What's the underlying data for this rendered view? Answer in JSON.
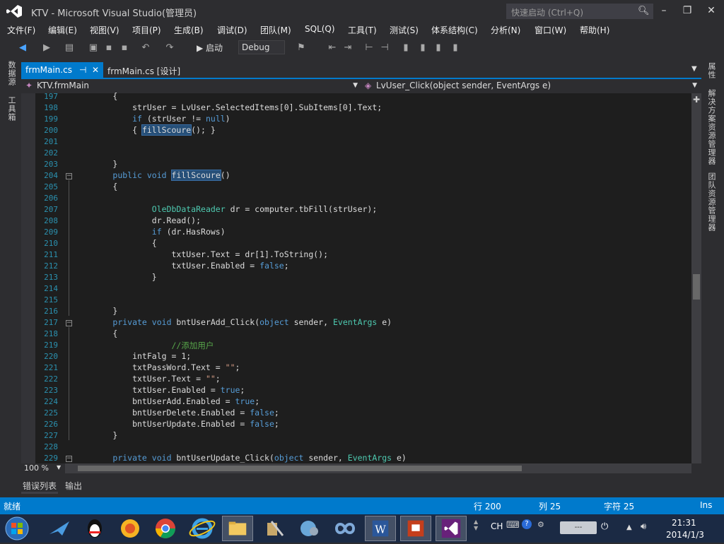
{
  "window": {
    "title": "KTV - Microsoft Visual Studio(管理员)",
    "quick_launch_placeholder": "快速启动 (Ctrl+Q)",
    "controls": {
      "minimize": "–",
      "maximize": "❐",
      "close": "✕"
    }
  },
  "menu": [
    "文件(F)",
    "编辑(E)",
    "视图(V)",
    "项目(P)",
    "生成(B)",
    "调试(D)",
    "团队(M)",
    "SQL(Q)",
    "工具(T)",
    "测试(S)",
    "体系结构(C)",
    "分析(N)",
    "窗口(W)",
    "帮助(H)"
  ],
  "toolbar": {
    "start_label": "▶ 启动",
    "configuration": "Debug"
  },
  "left_rail": [
    "数据源",
    "工具箱"
  ],
  "right_rail": [
    "属性",
    "解决方案资源管理器",
    "团队资源管理器"
  ],
  "tabs": [
    {
      "label": "frmMain.cs",
      "pin": "⊣",
      "close": "✕"
    },
    {
      "label": "frmMain.cs [设计]"
    }
  ],
  "navbar": {
    "class": "KTV.frmMain",
    "member": "LvUser_Click(object sender, EventArgs e)"
  },
  "code_lines": [
    {
      "n": "197",
      "text": "        {"
    },
    {
      "n": "198",
      "text": "            strUser = LvUser.SelectedItems[0].SubItems[0].Text;"
    },
    {
      "n": "199",
      "text": "            if (strUser != null)"
    },
    {
      "n": "200",
      "text": "            { fillScoure(); }"
    },
    {
      "n": "201",
      "text": ""
    },
    {
      "n": "202",
      "text": ""
    },
    {
      "n": "203",
      "text": "        }"
    },
    {
      "n": "204",
      "text": "        public void fillScoure()"
    },
    {
      "n": "205",
      "text": "        {"
    },
    {
      "n": "206",
      "text": ""
    },
    {
      "n": "207",
      "text": "                OleDbDataReader dr = computer.tbFill(strUser);"
    },
    {
      "n": "208",
      "text": "                dr.Read();"
    },
    {
      "n": "209",
      "text": "                if (dr.HasRows)"
    },
    {
      "n": "210",
      "text": "                {"
    },
    {
      "n": "211",
      "text": "                    txtUser.Text = dr[1].ToString();"
    },
    {
      "n": "212",
      "text": "                    txtUser.Enabled = false;"
    },
    {
      "n": "213",
      "text": "                }"
    },
    {
      "n": "214",
      "text": ""
    },
    {
      "n": "215",
      "text": ""
    },
    {
      "n": "216",
      "text": "        }"
    },
    {
      "n": "217",
      "text": "        private void bntUserAdd_Click(object sender, EventArgs e)"
    },
    {
      "n": "218",
      "text": "        {"
    },
    {
      "n": "219",
      "text": "                    //添加用户"
    },
    {
      "n": "220",
      "text": "            intFalg = 1;"
    },
    {
      "n": "221",
      "text": "            txtPassWord.Text = \"\";"
    },
    {
      "n": "222",
      "text": "            txtUser.Text = \"\";"
    },
    {
      "n": "223",
      "text": "            txtUser.Enabled = true;"
    },
    {
      "n": "224",
      "text": "            bntUserAdd.Enabled = true;"
    },
    {
      "n": "225",
      "text": "            bntUserDelete.Enabled = false;"
    },
    {
      "n": "226",
      "text": "            bntUserUpdate.Enabled = false;"
    },
    {
      "n": "227",
      "text": "        }"
    },
    {
      "n": "228",
      "text": ""
    },
    {
      "n": "229",
      "text": "        private void bntUserUpdate_Click(object sender, EventArgs e)"
    }
  ],
  "zoom": "100 %",
  "bottom_tabs": [
    "错误列表",
    "输出"
  ],
  "status": {
    "ready": "就绪",
    "line": "行 200",
    "col": "列 25",
    "char": "字符 25",
    "mode": "Ins"
  },
  "taskbar": {
    "time": "21:31",
    "date": "2014/1/3",
    "lang": "CH"
  }
}
